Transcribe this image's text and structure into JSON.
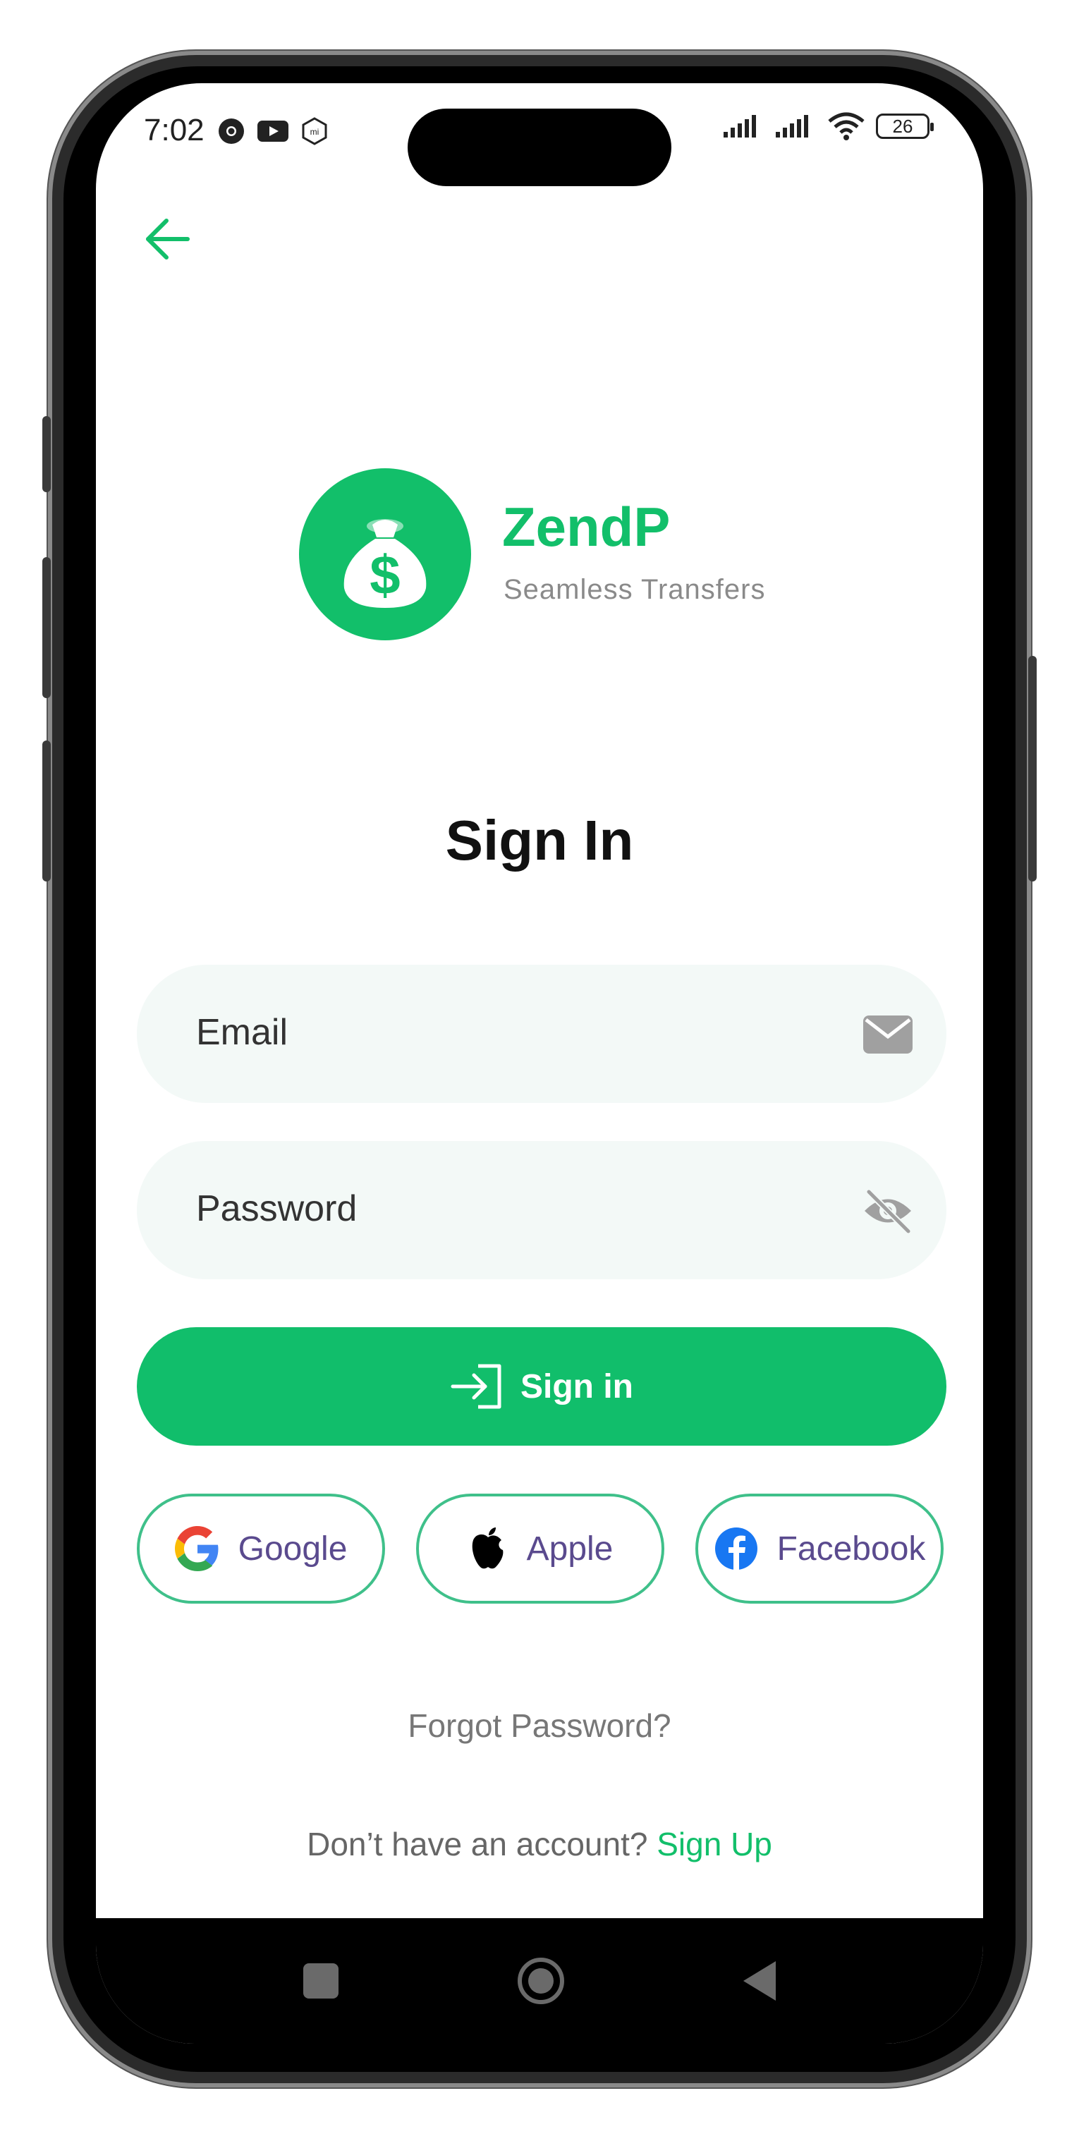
{
  "status_bar": {
    "time": "7:02",
    "battery": "26",
    "icons": [
      "chrome-icon",
      "youtube-icon",
      "mi-icon",
      "signal-icon",
      "signal-icon",
      "wifi-icon",
      "battery-icon"
    ]
  },
  "brand": {
    "name": "ZendP",
    "tagline": "Seamless Transfers",
    "logo_symbol": "$",
    "color": "#12bf6a"
  },
  "page": {
    "title": "Sign In"
  },
  "form": {
    "email_label": "Email",
    "password_label": "Password",
    "signin_label": "Sign in"
  },
  "social": {
    "google_label": "Google",
    "apple_label": "Apple",
    "facebook_label": "Facebook"
  },
  "links": {
    "forgot": "Forgot Password?",
    "no_account": "Don’t have an account?",
    "signup": "Sign Up"
  }
}
